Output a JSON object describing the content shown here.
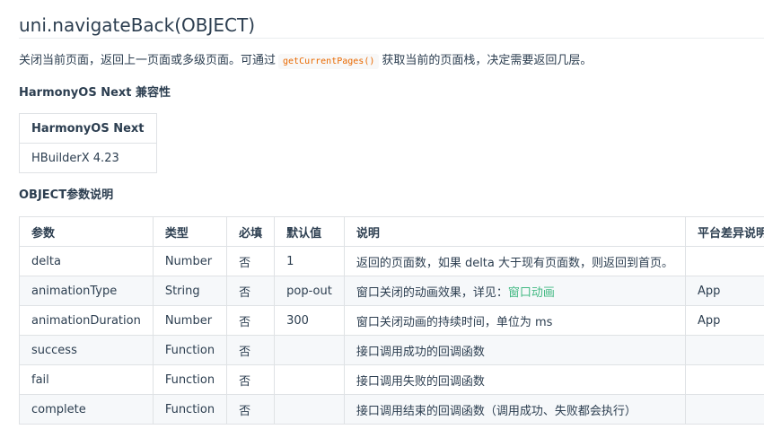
{
  "title": "uni.navigateBack(OBJECT)",
  "description": {
    "before": "关闭当前页面，返回上一页面或多级页面。可通过",
    "code": "getCurrentPages()",
    "after": "获取当前的页面栈，决定需要返回几层。"
  },
  "compat": {
    "heading": "HarmonyOS Next 兼容性",
    "header": "HarmonyOS Next",
    "value": "HBuilderX 4.23"
  },
  "params": {
    "heading": "OBJECT参数说明",
    "columns": [
      "参数",
      "类型",
      "必填",
      "默认值",
      "说明",
      "平台差异说明"
    ],
    "rows": [
      {
        "name": "delta",
        "type": "Number",
        "required": "否",
        "default": "1",
        "desc": "返回的页面数，如果 delta 大于现有页面数，则返回到首页。",
        "link": "",
        "platform": ""
      },
      {
        "name": "animationType",
        "type": "String",
        "required": "否",
        "default": "pop-out",
        "desc": "窗口关闭的动画效果，详见：",
        "link": "窗口动画",
        "platform": "App"
      },
      {
        "name": "animationDuration",
        "type": "Number",
        "required": "否",
        "default": "300",
        "desc": "窗口关闭动画的持续时间，单位为 ms",
        "link": "",
        "platform": "App"
      },
      {
        "name": "success",
        "type": "Function",
        "required": "否",
        "default": "",
        "desc": "接口调用成功的回调函数",
        "link": "",
        "platform": ""
      },
      {
        "name": "fail",
        "type": "Function",
        "required": "否",
        "default": "",
        "desc": "接口调用失败的回调函数",
        "link": "",
        "platform": ""
      },
      {
        "name": "complete",
        "type": "Function",
        "required": "否",
        "default": "",
        "desc": "接口调用结束的回调函数（调用成功、失败都会执行）",
        "link": "",
        "platform": ""
      }
    ]
  }
}
